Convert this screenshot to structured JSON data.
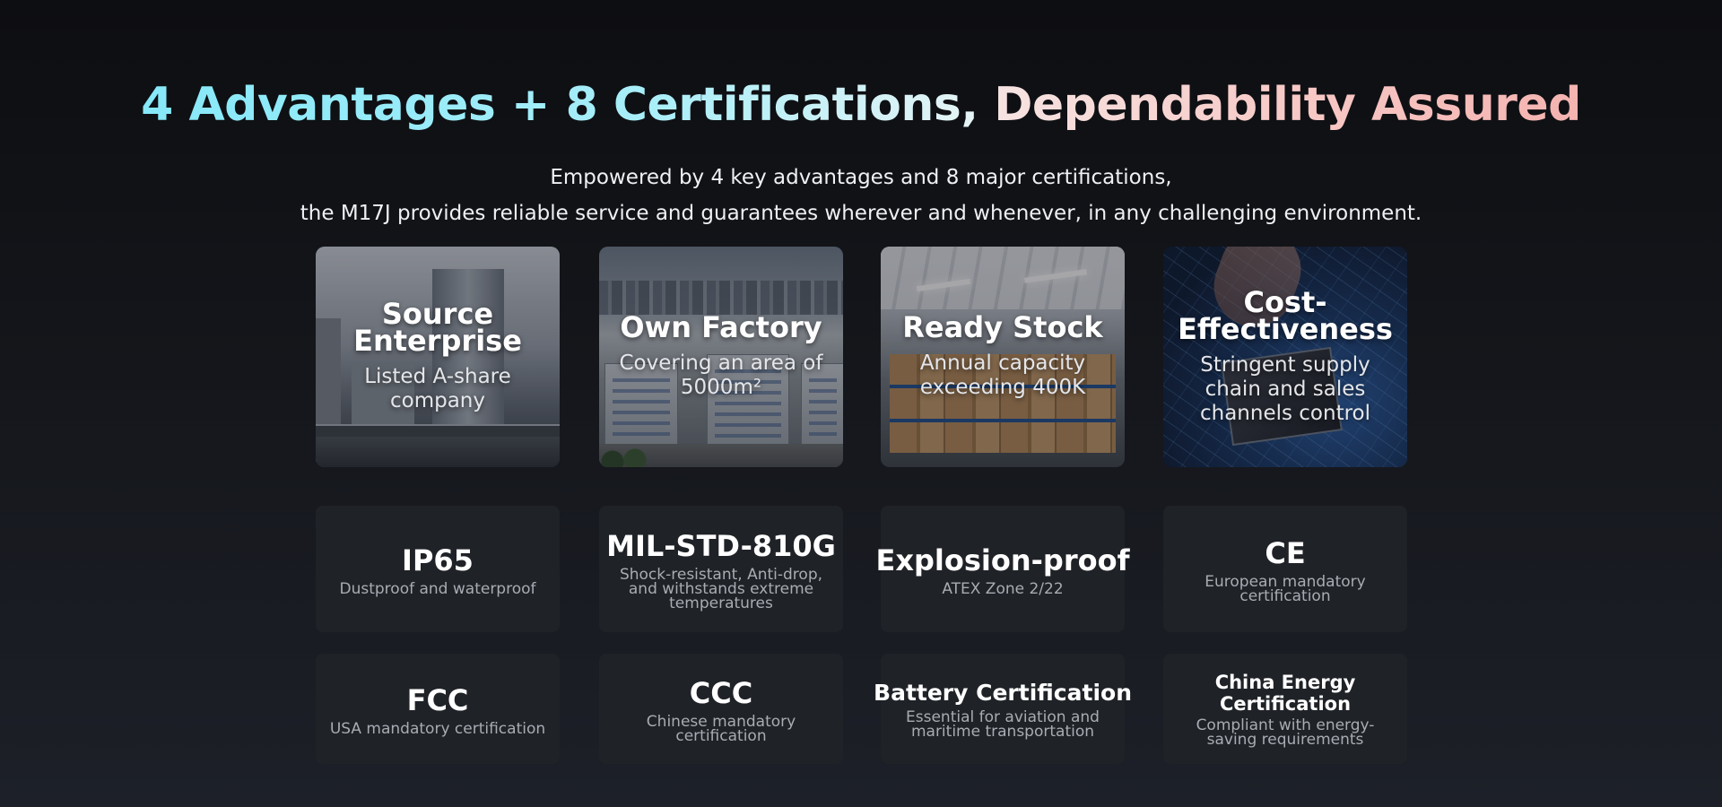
{
  "header": {
    "title_part1": "4 Advantages + 8 Certifications,",
    "title_part2": "Dependability Assured",
    "subtitle_line1": "Empowered by 4 key advantages and 8 major certifications,",
    "subtitle_line2": "the M17J provides reliable service and guarantees wherever and whenever, in any challenging environment."
  },
  "advantages": [
    {
      "title": "Source Enterprise",
      "desc": "Listed A-share company",
      "image": "office-building"
    },
    {
      "title": "Own Factory",
      "desc": "Covering an area of 5000m²",
      "image": "factory-aerial"
    },
    {
      "title": "Ready Stock",
      "desc": "Annual capacity exceeding 400K",
      "image": "warehouse-shelves"
    },
    {
      "title": "Cost-Effectiveness",
      "desc": "Stringent supply chain and sales channels control",
      "image": "circuit-chip"
    }
  ],
  "certifications": [
    {
      "title": "IP65",
      "desc": "Dustproof and waterproof"
    },
    {
      "title": "MIL-STD-810G",
      "desc": "Shock-resistant, Anti-drop, and withstands extreme temperatures"
    },
    {
      "title": "Explosion-proof",
      "desc": "ATEX Zone 2/22"
    },
    {
      "title": "CE",
      "desc": "European mandatory certification"
    },
    {
      "title": "FCC",
      "desc": "USA mandatory certification"
    },
    {
      "title": "CCC",
      "desc": "Chinese mandatory certification"
    },
    {
      "title": "Battery Certification",
      "desc": "Essential for aviation and maritime transportation"
    },
    {
      "title": "China Energy Certification",
      "desc": "Compliant with energy-saving requirements"
    }
  ],
  "colors": {
    "title_gradient_start": "#86e8f8",
    "title_gradient_end": "#f4b3b0",
    "card_bg": "#1f2227",
    "desc_text": "#a8acb3"
  }
}
